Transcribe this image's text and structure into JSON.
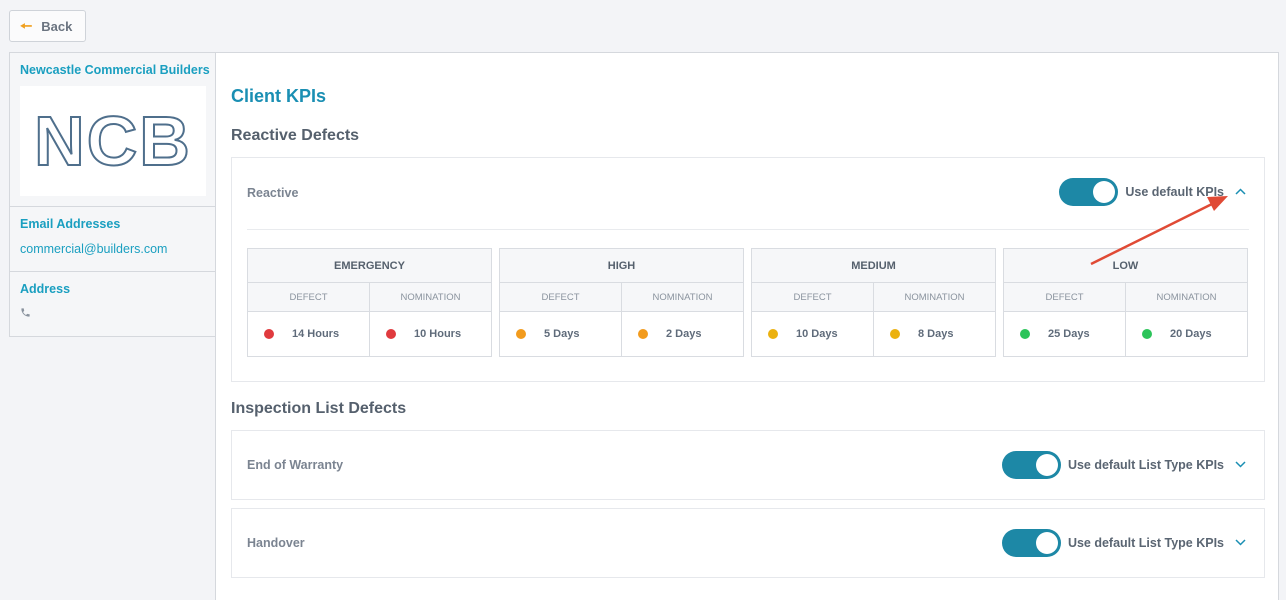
{
  "back_label": "Back",
  "sidebar": {
    "company_name": "Newcastle Commercial Builders",
    "logo_text": "NCB",
    "email_title": "Email Addresses",
    "email_value": "commercial@builders.com",
    "address_title": "Address",
    "phone_icon": "phone-icon"
  },
  "main": {
    "title": "Client KPIs",
    "reactive_heading": "Reactive Defects",
    "reactive_card": {
      "label": "Reactive",
      "toggle_label": "Use default KPIs",
      "toggle_on": true
    },
    "kpis": [
      {
        "name": "EMERGENCY",
        "defect_label": "DEFECT",
        "nomination_label": "NOMINATION",
        "defect": "14 Hours",
        "nomination": "10 Hours",
        "color": "#e03a3e"
      },
      {
        "name": "HIGH",
        "defect_label": "DEFECT",
        "nomination_label": "NOMINATION",
        "defect": "5 Days",
        "nomination": "2 Days",
        "color": "#f29b1d"
      },
      {
        "name": "MEDIUM",
        "defect_label": "DEFECT",
        "nomination_label": "NOMINATION",
        "defect": "10 Days",
        "nomination": "8 Days",
        "color": "#ebb10f"
      },
      {
        "name": "LOW",
        "defect_label": "DEFECT",
        "nomination_label": "NOMINATION",
        "defect": "25 Days",
        "nomination": "20 Days",
        "color": "#2cc45a"
      }
    ],
    "inspection_heading": "Inspection List Defects",
    "inspection_cards": [
      {
        "label": "End of Warranty",
        "toggle_label": "Use default List Type KPIs"
      },
      {
        "label": "Handover",
        "toggle_label": "Use default List Type KPIs"
      }
    ]
  },
  "colors": {
    "accent": "#1a9fc0",
    "toggle": "#1d88a6",
    "annotation_arrow": "#e04a35"
  }
}
